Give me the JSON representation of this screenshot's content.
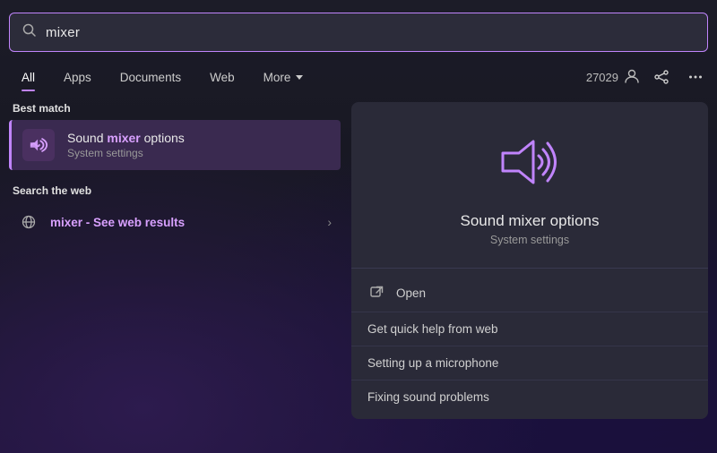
{
  "search": {
    "value": "mixer",
    "placeholder": "Search",
    "icon": "🔍"
  },
  "tabs": {
    "items": [
      {
        "id": "all",
        "label": "All",
        "active": true
      },
      {
        "id": "apps",
        "label": "Apps",
        "active": false
      },
      {
        "id": "documents",
        "label": "Documents",
        "active": false
      },
      {
        "id": "web",
        "label": "Web",
        "active": false
      },
      {
        "id": "more",
        "label": "More",
        "active": false
      }
    ],
    "user_count": "27029",
    "user_icon": "👤"
  },
  "best_match": {
    "section_label": "Best match",
    "title_prefix": "Sound ",
    "title_highlight": "mixer",
    "title_suffix": " options",
    "subtitle": "System settings"
  },
  "search_web": {
    "section_label": "Search the web",
    "query_highlight": "mixer",
    "query_suffix": " - See web results"
  },
  "right_panel": {
    "app_title": "Sound mixer options",
    "app_subtitle": "System settings",
    "open_label": "Open",
    "actions": [
      {
        "label": "Get quick help from web"
      },
      {
        "label": "Setting up a microphone"
      },
      {
        "label": "Fixing sound problems"
      }
    ]
  }
}
